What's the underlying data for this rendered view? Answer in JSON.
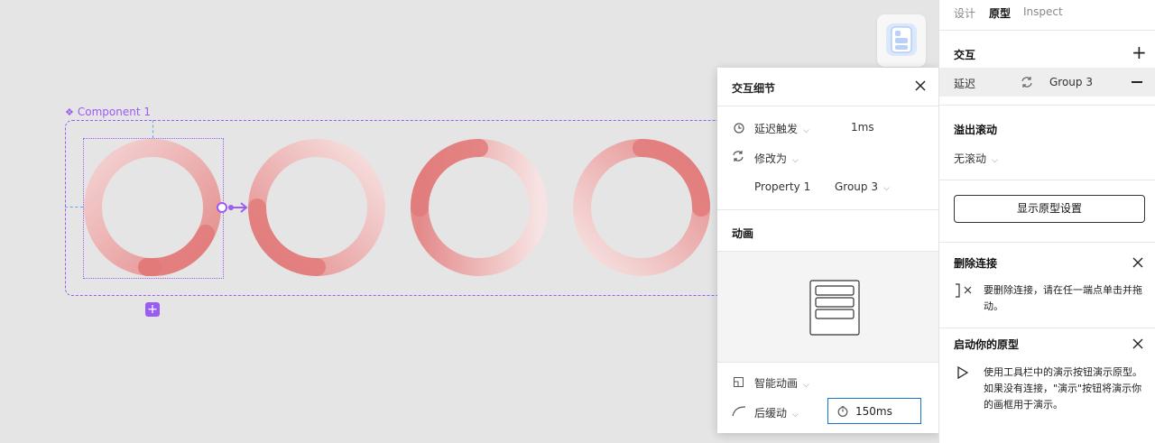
{
  "canvas": {
    "component_label": "Component 1",
    "ring_colors": {
      "start": "#e27a7a",
      "light": "#f7e3e3"
    }
  },
  "popup": {
    "title": "交互细节",
    "trigger_label": "延迟触发",
    "trigger_value": "1ms",
    "action_label": "修改为",
    "property_label": "Property 1",
    "property_value": "Group 3",
    "animation_title": "动画",
    "animation_type": "智能动画",
    "easing": "后缓动",
    "duration": "150ms"
  },
  "panel": {
    "tabs": [
      "设计",
      "原型",
      "Inspect"
    ],
    "active_tab": "原型",
    "interaction_title": "交互",
    "interaction_trigger": "延迟",
    "interaction_target": "Group 3",
    "overflow_title": "溢出滚动",
    "overflow_value": "无滚动",
    "show_settings_button": "显示原型设置",
    "delete_title": "删除连接",
    "delete_desc": "要删除连接，请在任一端点单击并拖动。",
    "start_title": "启动你的原型",
    "start_desc": "使用工具栏中的演示按钮演示原型。 如果没有连接，\"演示\"按钮将演示你的画框用于演示。"
  },
  "colors": {
    "accent": "#9b5cf4",
    "focus": "#1a73c8"
  }
}
